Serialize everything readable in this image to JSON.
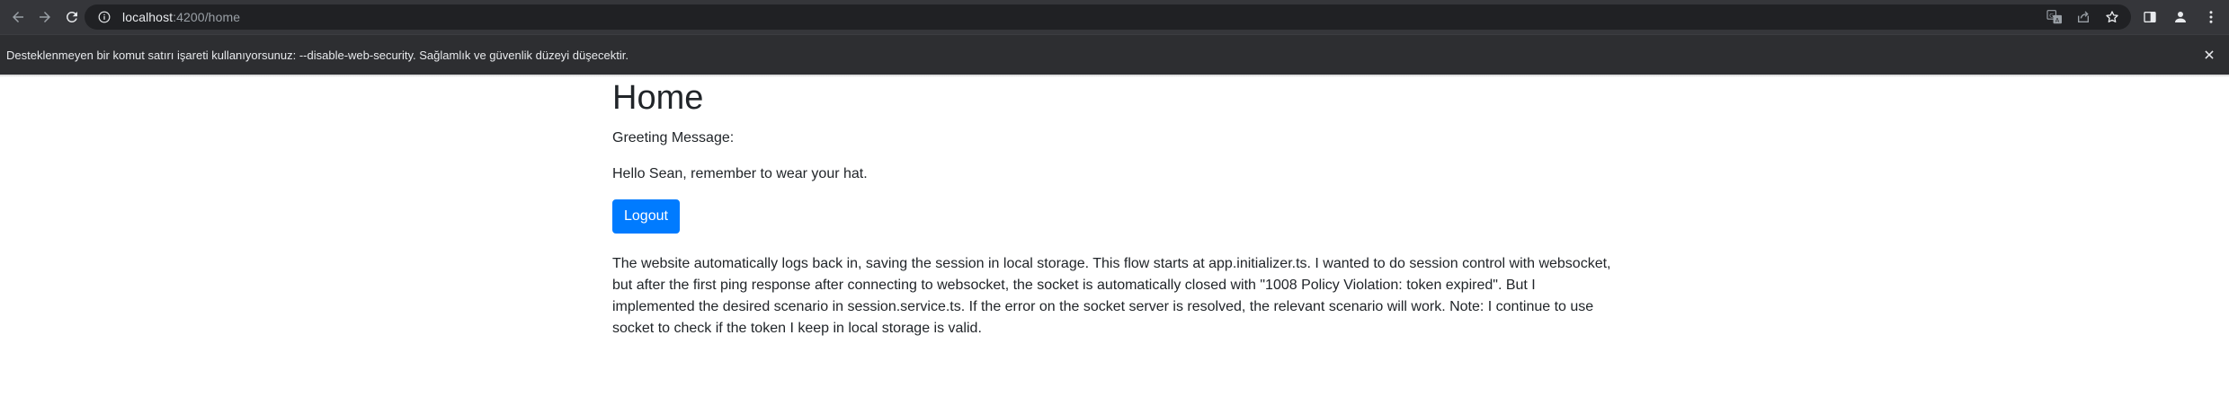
{
  "browser": {
    "url_host": "localhost",
    "url_path": ":4200/home",
    "icons": {
      "back": "arrow-left-icon",
      "forward": "arrow-right-icon",
      "reload": "reload-icon",
      "site_info": "info-icon",
      "translate": "translate-icon",
      "share": "share-icon",
      "bookmark": "star-icon",
      "side_panel": "side-panel-icon",
      "profile": "profile-icon",
      "menu": "kebab-menu-icon"
    }
  },
  "infobar": {
    "message": "Desteklenmeyen bir komut satırı işareti kullanıyorsunuz: --disable-web-security. Sağlamlık ve güvenlik düzeyi düşecektir.",
    "close_icon": "close-icon"
  },
  "page": {
    "title": "Home",
    "greeting_label": "Greeting Message:",
    "greeting_message": "Hello Sean, remember to wear your hat.",
    "logout_label": "Logout",
    "description": "The website automatically logs back in, saving the session in local storage. This flow starts at app.initializer.ts. I wanted to do session control with websocket, but after the first ping response after connecting to websocket, the socket is automatically closed with \"1008 Policy Violation: token expired\". But I implemented the desired scenario in session.service.ts. If the error on the socket server is resolved, the relevant scenario will work. Note: I continue to use socket to check if the token I keep in local storage is valid."
  },
  "colors": {
    "toolbar_bg": "#35363a",
    "omnibox_bg": "#202124",
    "infobar_bg": "#2d2e31",
    "primary_button": "#007bff",
    "text": "#212529"
  }
}
